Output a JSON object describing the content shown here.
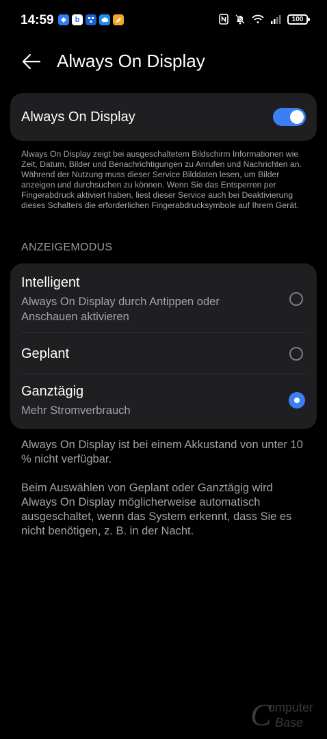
{
  "status_bar": {
    "time": "14:59",
    "battery": "100",
    "app_icon_colors": [
      "#2e7cf6",
      "#2b74ee",
      "#1a5fd8",
      "#1f8cf0",
      "#f5a623"
    ],
    "icons": [
      "nfc-icon",
      "mute-icon",
      "wifi-icon",
      "signal-icon",
      "battery-icon"
    ]
  },
  "header": {
    "title": "Always On Display"
  },
  "toggle": {
    "label": "Always On Display",
    "state": "on"
  },
  "description": "Always On Display zeigt bei ausgeschaltetem Bildschirm Informationen wie Zeit, Datum, Bilder und Benachrichtigungen zu Anrufen und Nachrichten an. Während der Nutzung muss dieser Service Bilddaten lesen, um Bilder anzeigen und durchsuchen zu können. Wenn Sie das Entsperren per Fingerabdruck aktiviert haben, liest dieser Service auch bei Deaktivierung dieses Schalters die erforderlichen Fingerabdrucksymbole auf Ihrem Gerät.",
  "mode": {
    "section_title": "ANZEIGEMODUS",
    "options": [
      {
        "title": "Intelligent",
        "subtitle": "Always On Display durch Antippen oder Anschauen aktivieren",
        "selected": false
      },
      {
        "title": "Geplant",
        "subtitle": "",
        "selected": false
      },
      {
        "title": "Ganztägig",
        "subtitle": "Mehr Stromverbrauch",
        "selected": true
      }
    ]
  },
  "notes": [
    "Always On Display ist bei einem Akkustand von unter 10 % nicht verfügbar.",
    "Beim Auswählen von Geplant oder Ganztägig wird Always On Display möglicherweise automatisch ausgeschaltet, wenn das System erkennt, dass Sie es nicht benötigen, z. B. in der Nacht."
  ],
  "colors": {
    "accent": "#3a7ff3",
    "card": "#1f1f21",
    "background": "#000000"
  }
}
